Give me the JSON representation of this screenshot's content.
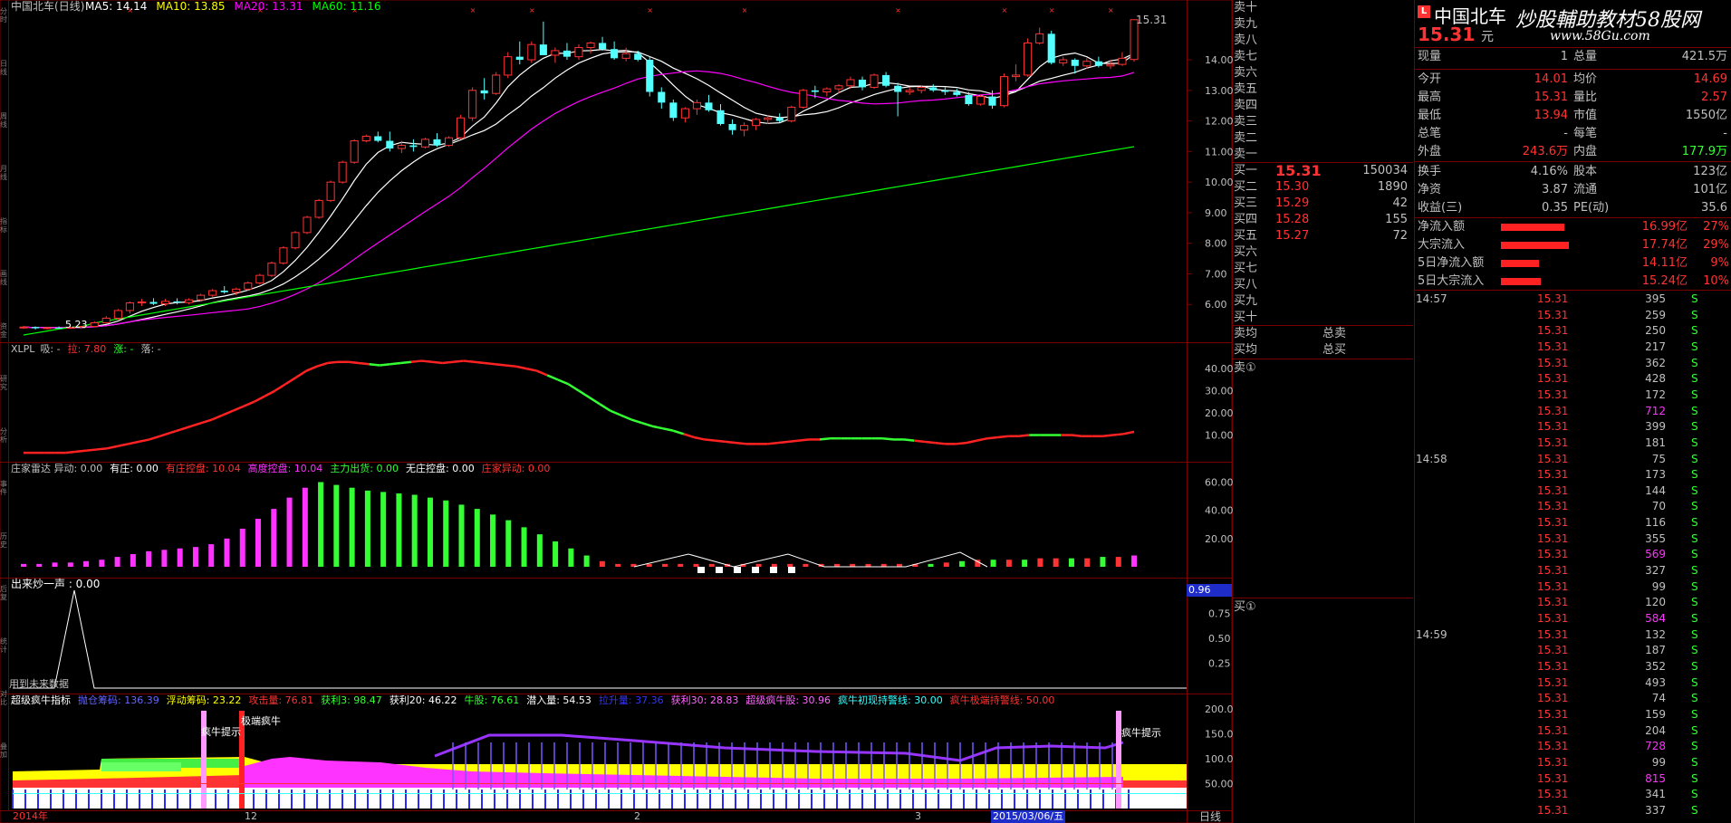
{
  "title": {
    "name": "中国北车",
    "period": "(日线)"
  },
  "ma_legend": [
    {
      "text": "MA5: 14.14",
      "color": "#ffffff"
    },
    {
      "text": "MA10: 13.85",
      "color": "#ffff00"
    },
    {
      "text": "MA20: 13.31",
      "color": "#ff00ff"
    },
    {
      "text": "MA60: 11.16",
      "color": "#00ff00"
    }
  ],
  "price_axis": [
    "14.00",
    "13.00",
    "12.00",
    "11.00",
    "10.00",
    "9.00",
    "8.00",
    "7.00",
    "6.00"
  ],
  "price_marks": {
    "high": "15.31",
    "low": "5.23"
  },
  "panels": {
    "xlpl": {
      "label": "XLPL",
      "items": [
        {
          "t": "吸: -",
          "c": "#c0c0c0"
        },
        {
          "t": "拉: 7.80",
          "c": "#ff3333"
        },
        {
          "t": "涨: -",
          "c": "#33ff33"
        },
        {
          "t": "落: -",
          "c": "#c0c0c0"
        }
      ],
      "axis": [
        "40.00",
        "30.00",
        "20.00",
        "10.00"
      ]
    },
    "zjld": {
      "items": [
        {
          "t": "庄家雷达 异动: 0.00",
          "c": "#c0c0c0"
        },
        {
          "t": "有庄: 0.00",
          "c": "#ffffff"
        },
        {
          "t": "有庄控盘: 10.04",
          "c": "#ff3333"
        },
        {
          "t": "高度控盘: 10.04",
          "c": "#ff33ff"
        },
        {
          "t": "主力出货: 0.00",
          "c": "#33ff33"
        },
        {
          "t": "无庄控盘: 0.00",
          "c": "#ffffff"
        },
        {
          "t": "庄家异动: 0.00",
          "c": "#ff3333"
        }
      ],
      "axis": [
        "60.00",
        "40.00",
        "20.00"
      ]
    },
    "cmqy": {
      "label": "出来炒一声 : 0.00",
      "axis": [
        "0.75",
        "0.50",
        "0.25"
      ],
      "box": "0.96",
      "note": "用到未来数据"
    },
    "cjnn": {
      "items": [
        {
          "t": "超级疯牛指标",
          "c": "#ffffff"
        },
        {
          "t": "抛仓筹码: 136.39",
          "c": "#6666ff"
        },
        {
          "t": "浮动筹码: 23.22",
          "c": "#ffff00"
        },
        {
          "t": "攻击量: 76.81",
          "c": "#ff3333"
        },
        {
          "t": "获利3: 98.47",
          "c": "#33ff33"
        },
        {
          "t": "获利20: 46.22",
          "c": "#ffffff"
        },
        {
          "t": "牛股: 76.61",
          "c": "#33ff33"
        },
        {
          "t": "潜入量: 54.53",
          "c": "#ffffff"
        },
        {
          "t": "拉升量: 37.36",
          "c": "#3333ff"
        },
        {
          "t": "获利30: 28.83",
          "c": "#ff66ff"
        },
        {
          "t": "超级疯牛股: 30.96",
          "c": "#ff66ff"
        },
        {
          "t": "疯牛初现持警线: 30.00",
          "c": "#33ffff"
        },
        {
          "t": "疯牛极端持警线: 50.00",
          "c": "#ff3333"
        }
      ],
      "axis": [
        "200.0",
        "150.0",
        "100.0",
        "50.00"
      ],
      "ann": [
        "疯牛提示",
        "极端疯牛",
        "疯牛提示"
      ]
    }
  },
  "date_axis": [
    {
      "t": "2014年",
      "c": "#ff3333"
    },
    {
      "t": "12",
      "c": "#c0c0c0"
    },
    {
      "t": "2",
      "c": "#c0c0c0"
    },
    {
      "t": "3",
      "c": "#c0c0c0"
    }
  ],
  "date_cursor": "2015/03/06/五",
  "period_label": "日线",
  "left_toolbar": [
    "分时",
    "日线",
    "周线",
    "月线",
    "指标",
    "画线",
    "资金",
    "研究",
    "分析",
    "事件",
    "历史",
    "后复",
    "统计",
    "对比",
    "叠加"
  ],
  "order_book": {
    "sell_labels": [
      "卖十",
      "卖九",
      "卖八",
      "卖七",
      "卖六",
      "卖五",
      "卖四",
      "卖三",
      "卖二",
      "卖一"
    ],
    "buy": [
      {
        "label": "买一",
        "price": "15.31",
        "vol": "150034"
      },
      {
        "label": "买二",
        "price": "15.30",
        "vol": "1890"
      },
      {
        "label": "买三",
        "price": "15.29",
        "vol": "42"
      },
      {
        "label": "买四",
        "price": "15.28",
        "vol": "155"
      },
      {
        "label": "买五",
        "price": "15.27",
        "vol": "72"
      },
      {
        "label": "买六",
        "price": "",
        "vol": ""
      },
      {
        "label": "买七",
        "price": "",
        "vol": ""
      },
      {
        "label": "买八",
        "price": "",
        "vol": ""
      },
      {
        "label": "买九",
        "price": "",
        "vol": ""
      },
      {
        "label": "买十",
        "price": "",
        "vol": ""
      }
    ],
    "avg_rows": [
      {
        "l": "卖均",
        "r": "总卖"
      },
      {
        "l": "买均",
        "r": "总买"
      }
    ],
    "sell_queue": "卖①",
    "buy_queue": "买①"
  },
  "quote": {
    "badge": "L",
    "name": "中国北车",
    "watermark": "炒股輔助教材58股网",
    "watermark2": "www.58Gu.com",
    "price": "15.31",
    "unit": "元",
    "rows1": [
      {
        "l": "现量",
        "v": "1",
        "l2": "总量",
        "v2": "421.5万"
      }
    ],
    "rows2": [
      {
        "l": "今开",
        "v": "14.01",
        "vc": "#ff3333",
        "l2": "均价",
        "v2": "14.69",
        "v2c": "#ff3333"
      },
      {
        "l": "最高",
        "v": "15.31",
        "vc": "#ff3333",
        "l2": "量比",
        "v2": "2.57",
        "v2c": "#ff3333"
      },
      {
        "l": "最低",
        "v": "13.94",
        "vc": "#ff3333",
        "l2": "市值",
        "v2": "1550亿",
        "v2c": "#c0c0c0"
      },
      {
        "l": "总笔",
        "v": "-",
        "vc": "#c0c0c0",
        "l2": "每笔",
        "v2": "-",
        "v2c": "#c0c0c0"
      },
      {
        "l": "外盘",
        "v": "243.6万",
        "vc": "#ff3333",
        "l2": "内盘",
        "v2": "177.9万",
        "v2c": "#33ff33"
      }
    ],
    "rows3": [
      {
        "l": "换手",
        "v": "4.16%",
        "l2": "股本",
        "v2": "123亿"
      },
      {
        "l": "净资",
        "v": "3.87",
        "l2": "流通",
        "v2": "101亿"
      },
      {
        "l": "收益(三)",
        "v": "0.35",
        "l2": "PE(动)",
        "v2": "35.6"
      }
    ],
    "flows": [
      {
        "l": "净流入额",
        "v": "16.99亿",
        "p": "27%",
        "bar": 0.27
      },
      {
        "l": "大宗流入",
        "v": "17.74亿",
        "p": "29%",
        "bar": 0.29
      },
      {
        "l": "5日净流入额",
        "v": "14.11亿",
        "p": "9%",
        "bar": 0.16
      },
      {
        "l": "5日大宗流入",
        "v": "15.24亿",
        "p": "10%",
        "bar": 0.17
      }
    ]
  },
  "ticks": [
    {
      "t": "14:57",
      "p": "15.31",
      "v": "395",
      "s": "S",
      "vc": "#c0c0c0"
    },
    {
      "t": "",
      "p": "15.31",
      "v": "259",
      "s": "S",
      "vc": "#c0c0c0"
    },
    {
      "t": "",
      "p": "15.31",
      "v": "250",
      "s": "S",
      "vc": "#c0c0c0"
    },
    {
      "t": "",
      "p": "15.31",
      "v": "217",
      "s": "S",
      "vc": "#c0c0c0"
    },
    {
      "t": "",
      "p": "15.31",
      "v": "362",
      "s": "S",
      "vc": "#c0c0c0"
    },
    {
      "t": "",
      "p": "15.31",
      "v": "428",
      "s": "S",
      "vc": "#c0c0c0"
    },
    {
      "t": "",
      "p": "15.31",
      "v": "172",
      "s": "S",
      "vc": "#c0c0c0"
    },
    {
      "t": "",
      "p": "15.31",
      "v": "712",
      "s": "S",
      "vc": "#ff33ff"
    },
    {
      "t": "",
      "p": "15.31",
      "v": "399",
      "s": "S",
      "vc": "#c0c0c0"
    },
    {
      "t": "",
      "p": "15.31",
      "v": "181",
      "s": "S",
      "vc": "#c0c0c0"
    },
    {
      "t": "14:58",
      "p": "15.31",
      "v": "75",
      "s": "S",
      "vc": "#c0c0c0"
    },
    {
      "t": "",
      "p": "15.31",
      "v": "173",
      "s": "S",
      "vc": "#c0c0c0"
    },
    {
      "t": "",
      "p": "15.31",
      "v": "144",
      "s": "S",
      "vc": "#c0c0c0"
    },
    {
      "t": "",
      "p": "15.31",
      "v": "70",
      "s": "S",
      "vc": "#c0c0c0"
    },
    {
      "t": "",
      "p": "15.31",
      "v": "116",
      "s": "S",
      "vc": "#c0c0c0"
    },
    {
      "t": "",
      "p": "15.31",
      "v": "355",
      "s": "S",
      "vc": "#c0c0c0"
    },
    {
      "t": "",
      "p": "15.31",
      "v": "569",
      "s": "S",
      "vc": "#ff33ff"
    },
    {
      "t": "",
      "p": "15.31",
      "v": "327",
      "s": "S",
      "vc": "#c0c0c0"
    },
    {
      "t": "",
      "p": "15.31",
      "v": "99",
      "s": "S",
      "vc": "#c0c0c0"
    },
    {
      "t": "",
      "p": "15.31",
      "v": "120",
      "s": "S",
      "vc": "#c0c0c0"
    },
    {
      "t": "",
      "p": "15.31",
      "v": "584",
      "s": "S",
      "vc": "#ff33ff"
    },
    {
      "t": "14:59",
      "p": "15.31",
      "v": "132",
      "s": "S",
      "vc": "#c0c0c0"
    },
    {
      "t": "",
      "p": "15.31",
      "v": "187",
      "s": "S",
      "vc": "#c0c0c0"
    },
    {
      "t": "",
      "p": "15.31",
      "v": "352",
      "s": "S",
      "vc": "#c0c0c0"
    },
    {
      "t": "",
      "p": "15.31",
      "v": "493",
      "s": "S",
      "vc": "#c0c0c0"
    },
    {
      "t": "",
      "p": "15.31",
      "v": "74",
      "s": "S",
      "vc": "#c0c0c0"
    },
    {
      "t": "",
      "p": "15.31",
      "v": "159",
      "s": "S",
      "vc": "#c0c0c0"
    },
    {
      "t": "",
      "p": "15.31",
      "v": "204",
      "s": "S",
      "vc": "#c0c0c0"
    },
    {
      "t": "",
      "p": "15.31",
      "v": "728",
      "s": "S",
      "vc": "#ff33ff"
    },
    {
      "t": "",
      "p": "15.31",
      "v": "99",
      "s": "S",
      "vc": "#c0c0c0"
    },
    {
      "t": "",
      "p": "15.31",
      "v": "815",
      "s": "S",
      "vc": "#ff33ff"
    },
    {
      "t": "",
      "p": "15.31",
      "v": "341",
      "s": "S",
      "vc": "#c0c0c0"
    },
    {
      "t": "",
      "p": "15.31",
      "v": "337",
      "s": "S",
      "vc": "#c0c0c0"
    }
  ],
  "colors": {
    "up": "#ff3333",
    "down": "#54ffff",
    "ma5": "#ffffff",
    "ma10": "#ffff00",
    "ma20": "#ff00ff",
    "ma60": "#00ff00",
    "grid": "#7a0000"
  },
  "chart_data": {
    "type": "candlestick",
    "title": "中国北车(日线)",
    "ylim": [
      5.0,
      15.6
    ],
    "candles": [
      [
        5.25,
        5.3,
        5.2,
        5.26
      ],
      [
        5.26,
        5.28,
        5.18,
        5.22
      ],
      [
        5.22,
        5.26,
        5.18,
        5.24
      ],
      [
        5.24,
        5.28,
        5.2,
        5.23
      ],
      [
        5.23,
        5.27,
        5.2,
        5.25
      ],
      [
        5.25,
        5.3,
        5.22,
        5.28
      ],
      [
        5.28,
        5.45,
        5.25,
        5.4
      ],
      [
        5.4,
        5.62,
        5.35,
        5.55
      ],
      [
        5.55,
        5.85,
        5.5,
        5.8
      ],
      [
        5.8,
        6.1,
        5.7,
        6.05
      ],
      [
        6.05,
        6.18,
        5.95,
        6.08
      ],
      [
        6.08,
        6.2,
        5.98,
        6.02
      ],
      [
        6.02,
        6.18,
        5.95,
        6.1
      ],
      [
        6.1,
        6.2,
        6.0,
        6.06
      ],
      [
        6.06,
        6.2,
        6.0,
        6.15
      ],
      [
        6.15,
        6.35,
        6.1,
        6.3
      ],
      [
        6.3,
        6.5,
        6.25,
        6.45
      ],
      [
        6.45,
        6.6,
        6.35,
        6.4
      ],
      [
        6.4,
        6.55,
        6.3,
        6.5
      ],
      [
        6.5,
        6.75,
        6.45,
        6.7
      ],
      [
        6.7,
        7.0,
        6.65,
        6.95
      ],
      [
        6.95,
        7.4,
        6.9,
        7.35
      ],
      [
        7.35,
        7.9,
        7.3,
        7.85
      ],
      [
        7.85,
        8.4,
        7.8,
        8.35
      ],
      [
        8.35,
        8.9,
        8.3,
        8.85
      ],
      [
        8.85,
        9.45,
        8.8,
        9.4
      ],
      [
        9.4,
        10.05,
        9.35,
        10.0
      ],
      [
        10.0,
        10.7,
        9.95,
        10.65
      ],
      [
        10.65,
        11.4,
        10.6,
        11.35
      ],
      [
        11.35,
        11.55,
        11.3,
        11.5
      ],
      [
        11.5,
        11.65,
        11.3,
        11.35
      ],
      [
        11.35,
        11.65,
        11.0,
        11.1
      ],
      [
        11.1,
        11.35,
        10.95,
        11.2
      ],
      [
        11.2,
        11.4,
        11.0,
        11.15
      ],
      [
        11.15,
        11.45,
        11.1,
        11.4
      ],
      [
        11.4,
        11.6,
        11.15,
        11.2
      ],
      [
        11.2,
        11.5,
        11.15,
        11.45
      ],
      [
        11.45,
        12.2,
        11.4,
        12.1
      ],
      [
        12.1,
        13.1,
        12.0,
        13.0
      ],
      [
        13.0,
        13.4,
        12.7,
        12.9
      ],
      [
        12.9,
        13.6,
        12.85,
        13.5
      ],
      [
        13.5,
        14.25,
        13.4,
        14.1
      ],
      [
        14.1,
        14.6,
        13.85,
        14.0
      ],
      [
        14.0,
        14.6,
        13.9,
        14.5
      ],
      [
        14.5,
        15.25,
        14.2,
        14.15
      ],
      [
        14.15,
        14.4,
        13.9,
        14.3
      ],
      [
        14.3,
        14.55,
        14.0,
        14.1
      ],
      [
        14.1,
        14.5,
        14.0,
        14.4
      ],
      [
        14.4,
        14.6,
        14.2,
        14.55
      ],
      [
        14.55,
        14.75,
        14.3,
        14.35
      ],
      [
        14.35,
        14.6,
        14.0,
        14.05
      ],
      [
        14.05,
        14.4,
        13.95,
        14.2
      ],
      [
        14.2,
        14.3,
        13.95,
        14.0
      ],
      [
        14.0,
        14.1,
        12.8,
        12.95
      ],
      [
        12.95,
        13.1,
        12.4,
        12.6
      ],
      [
        12.6,
        12.7,
        12.0,
        12.1
      ],
      [
        12.1,
        12.45,
        11.95,
        12.4
      ],
      [
        12.4,
        12.7,
        12.2,
        12.6
      ],
      [
        12.6,
        12.85,
        12.3,
        12.35
      ],
      [
        12.35,
        12.55,
        11.85,
        11.9
      ],
      [
        11.9,
        12.05,
        11.55,
        11.7
      ],
      [
        11.7,
        11.95,
        11.5,
        11.85
      ],
      [
        11.85,
        12.1,
        11.7,
        12.05
      ],
      [
        12.05,
        12.2,
        11.9,
        12.1
      ],
      [
        12.1,
        12.25,
        11.95,
        12.0
      ],
      [
        12.0,
        12.5,
        11.95,
        12.45
      ],
      [
        12.45,
        13.05,
        12.4,
        13.0
      ],
      [
        13.0,
        13.15,
        12.75,
        12.95
      ],
      [
        12.95,
        13.1,
        12.8,
        13.05
      ],
      [
        13.05,
        13.2,
        12.9,
        13.15
      ],
      [
        13.15,
        13.45,
        13.05,
        13.35
      ],
      [
        13.35,
        13.45,
        13.0,
        13.1
      ],
      [
        13.1,
        13.55,
        13.05,
        13.5
      ],
      [
        13.5,
        13.6,
        13.1,
        13.15
      ],
      [
        13.15,
        13.25,
        12.15,
        12.95
      ],
      [
        12.95,
        13.1,
        12.85,
        13.0
      ],
      [
        13.0,
        13.15,
        12.9,
        13.1
      ],
      [
        13.1,
        13.2,
        12.95,
        13.0
      ],
      [
        13.0,
        13.1,
        12.85,
        12.95
      ],
      [
        12.95,
        13.05,
        12.8,
        12.85
      ],
      [
        12.85,
        12.95,
        12.5,
        12.55
      ],
      [
        12.55,
        12.85,
        12.5,
        12.8
      ],
      [
        12.8,
        13.0,
        12.4,
        12.5
      ],
      [
        12.5,
        13.55,
        12.45,
        13.45
      ],
      [
        13.45,
        13.85,
        13.3,
        13.5
      ],
      [
        13.5,
        14.7,
        13.45,
        14.55
      ],
      [
        14.55,
        15.05,
        14.5,
        14.85
      ],
      [
        14.85,
        14.95,
        13.85,
        13.9
      ],
      [
        13.9,
        14.1,
        13.8,
        14.0
      ],
      [
        14.0,
        14.05,
        13.55,
        13.8
      ],
      [
        13.8,
        14.05,
        13.7,
        13.95
      ],
      [
        13.95,
        14.1,
        13.75,
        13.8
      ],
      [
        13.8,
        14.0,
        13.7,
        13.85
      ],
      [
        13.85,
        14.25,
        13.8,
        14.05
      ],
      [
        14.01,
        15.31,
        13.94,
        15.31
      ]
    ],
    "xlpl_series": [
      2,
      2,
      2,
      2,
      2,
      2.5,
      3,
      3.5,
      4,
      5,
      6,
      7,
      8,
      9.5,
      11,
      12.5,
      14,
      15.5,
      17,
      19,
      21,
      23,
      25,
      27.5,
      30,
      33,
      36,
      39,
      41,
      42.5,
      43,
      43,
      42.5,
      42,
      41.5,
      42,
      42.5,
      43,
      43.5,
      43,
      42.5,
      43,
      43.5,
      43,
      42.5,
      42,
      41.5,
      41,
      40,
      39,
      37,
      35,
      33,
      30,
      27,
      24,
      21,
      19,
      17,
      15.5,
      14,
      13,
      12,
      10.5,
      9,
      8,
      7.5,
      7,
      6.5,
      6,
      6,
      6,
      6.5,
      7,
      7.5,
      8,
      8,
      8.5,
      8.5,
      8.5,
      8.5,
      8.5,
      8.5,
      8,
      8,
      7.5,
      7,
      6.5,
      6,
      6,
      6.5,
      7.5,
      8.5,
      9,
      9.5,
      9.5,
      10,
      10,
      10,
      10,
      10,
      9.5,
      9.5,
      9.5,
      10,
      10.5,
      11.5
    ],
    "zjld_bars": [
      2,
      2,
      3,
      3,
      4,
      5,
      7,
      9,
      11,
      12,
      13,
      14,
      16,
      20,
      27,
      34,
      41,
      49,
      56,
      60,
      58,
      56,
      54,
      53,
      52,
      51,
      49,
      47,
      44,
      41,
      37,
      33,
      28,
      23,
      18,
      13,
      8,
      4,
      2,
      2,
      2,
      2,
      2,
      2,
      2,
      2,
      2,
      2,
      2,
      2,
      2,
      2,
      2,
      2,
      2,
      2,
      2,
      2,
      2,
      3,
      4,
      5,
      5,
      5,
      5,
      6,
      6,
      6,
      6,
      7,
      7,
      8
    ]
  }
}
